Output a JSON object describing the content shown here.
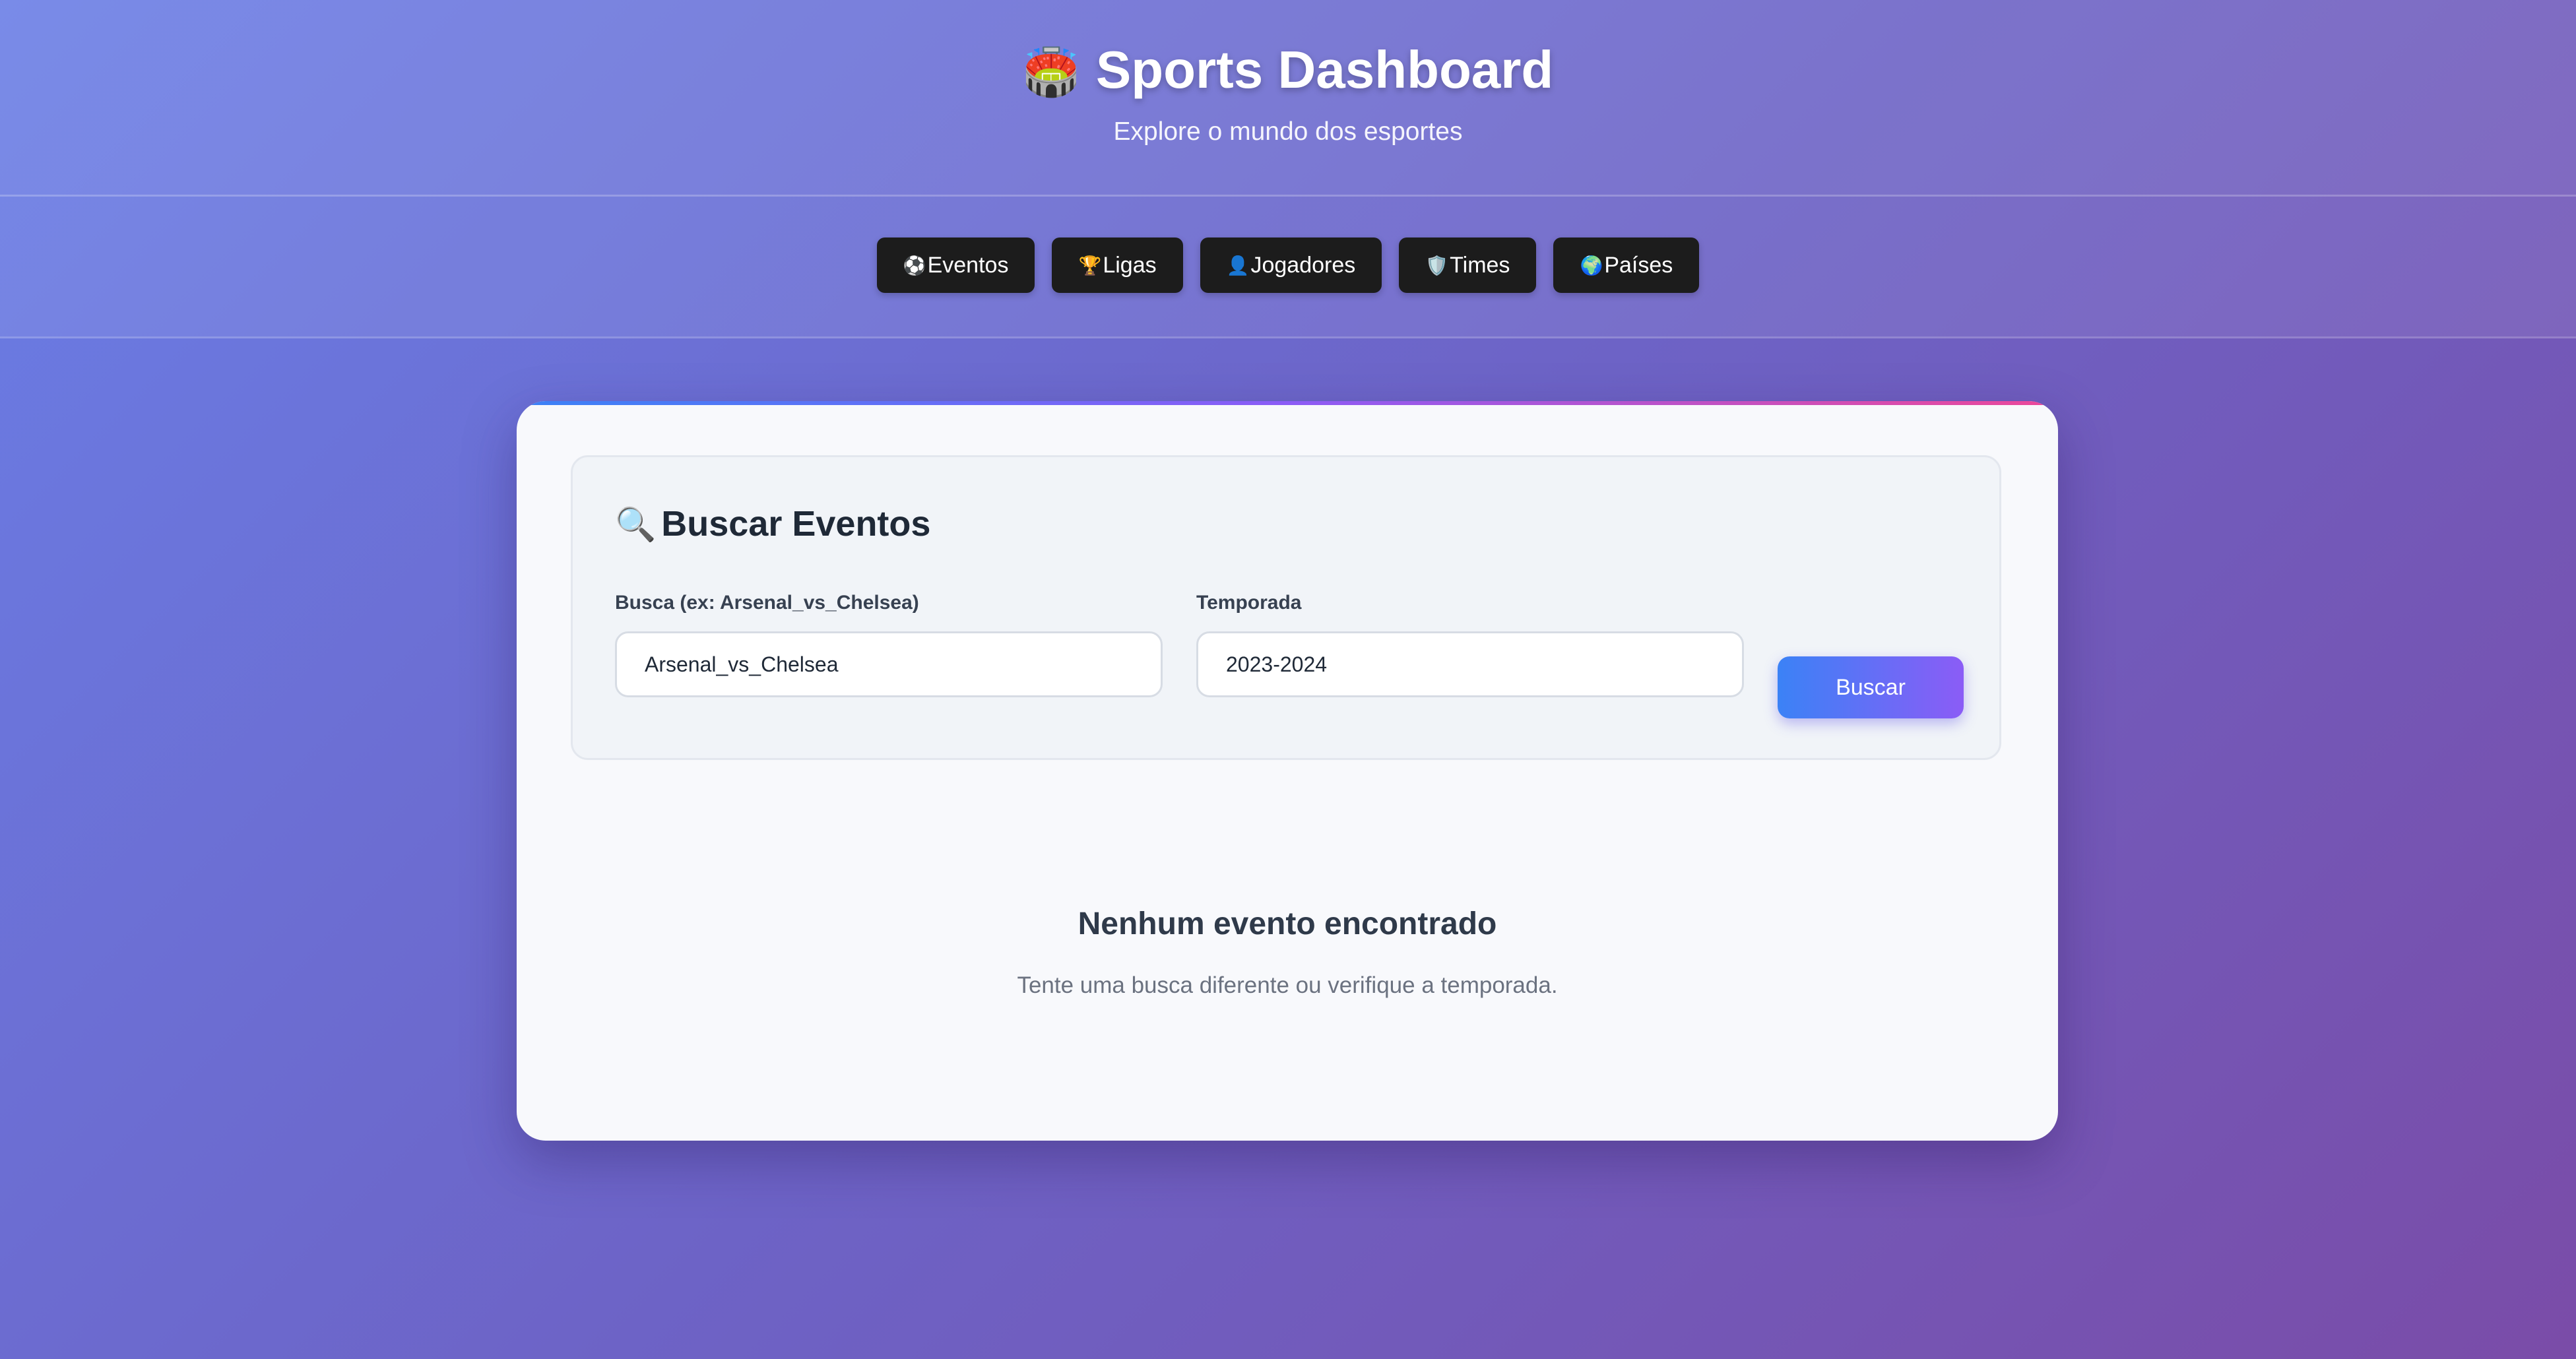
{
  "header": {
    "title_icon": "🏟️",
    "title": "Sports Dashboard",
    "subtitle": "Explore o mundo dos esportes"
  },
  "nav": {
    "items": [
      {
        "icon": "⚽",
        "label": "Eventos"
      },
      {
        "icon": "🏆",
        "label": "Ligas"
      },
      {
        "icon": "👤",
        "label": "Jogadores"
      },
      {
        "icon": "🛡️",
        "label": "Times"
      },
      {
        "icon": "🌍",
        "label": "Países"
      }
    ]
  },
  "search": {
    "title_icon": "🔍",
    "title": "Buscar Eventos",
    "query_label": "Busca (ex: Arsenal_vs_Chelsea)",
    "query_value": "Arsenal_vs_Chelsea",
    "season_label": "Temporada",
    "season_value": "2023-2024",
    "button_label": "Buscar"
  },
  "empty_state": {
    "title": "Nenhum evento encontrado",
    "message": "Tente uma busca diferente ou verifique a temporada."
  },
  "colors": {
    "accent_start": "#3b82f6",
    "accent_end": "#8b5cf6",
    "nav_button": "#1c1c1c"
  }
}
